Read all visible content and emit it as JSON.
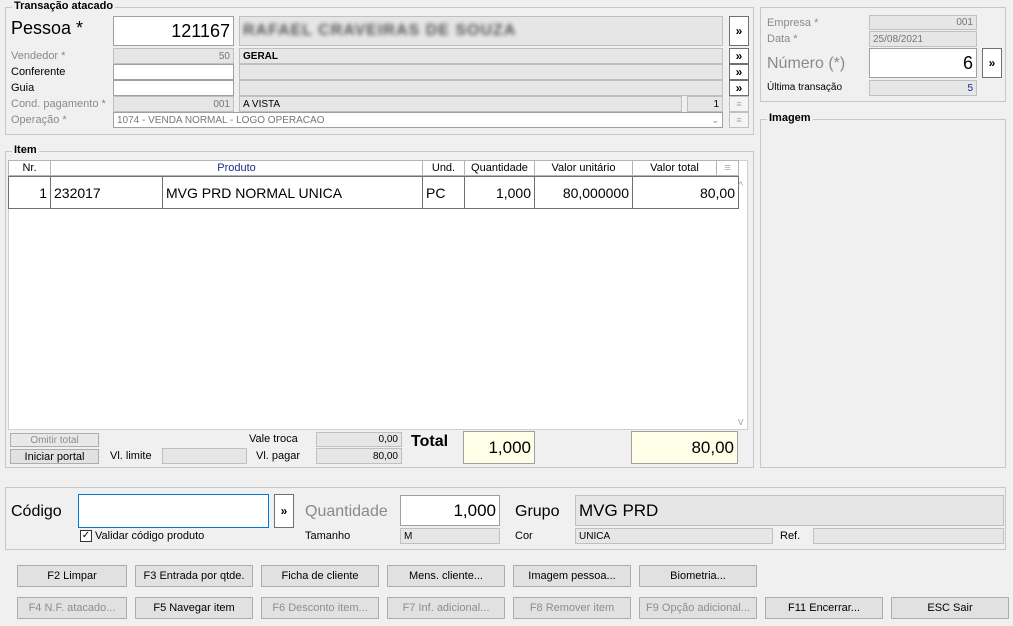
{
  "transacao": {
    "title": "Transação atacado",
    "pessoa_label": "Pessoa *",
    "pessoa_code": "121167",
    "pessoa_name": "RAFAEL CRAVEIRAS DE SOUZA",
    "vendedor_label": "Vendedor *",
    "vendedor_code": "50",
    "vendedor_name": "GERAL",
    "conferente_label": "Conferente",
    "guia_label": "Guia",
    "cond_label": "Cond. pagamento *",
    "cond_code": "001",
    "cond_name": "A VISTA",
    "cond_parcelas": "1",
    "operacao_label": "Operação *",
    "operacao_value": "1074 - VENDA NORMAL - LOGO OPERACAO"
  },
  "empresa": {
    "empresa_label": "Empresa *",
    "empresa_value": "001",
    "data_label": "Data *",
    "data_value": "25/08/2021",
    "numero_label": "Número (*)",
    "numero_value": "6",
    "ultima_label": "Última transação",
    "ultima_value": "5"
  },
  "imagem": {
    "title": "Imagem"
  },
  "item": {
    "title": "Item",
    "columns": [
      "Nr.",
      "Produto",
      "Und.",
      "Quantidade",
      "Valor unitário",
      "Valor total"
    ],
    "rows": [
      {
        "nr": "1",
        "codigo": "232017",
        "produto": "MVG PRD NORMAL UNICA",
        "und": "PC",
        "quantidade": "1,000",
        "valor_unitario": "80,000000",
        "valor_total": "80,00"
      }
    ]
  },
  "totals": {
    "omitir_total": "Omitir total",
    "iniciar_portal": "Iniciar portal",
    "vl_limite_label": "Vl. limite",
    "vl_limite_value": "",
    "vale_troca_label": "Vale troca",
    "vale_troca_value": "0,00",
    "vl_pagar_label": "Vl. pagar",
    "vl_pagar_value": "80,00",
    "total_label": "Total",
    "total_quantidade": "1,000",
    "total_valor": "80,00"
  },
  "codigo": {
    "codigo_label": "Código",
    "codigo_value": "",
    "validar_label": "Validar código produto",
    "validar_checked": true,
    "quantidade_label": "Quantidade",
    "quantidade_value": "1,000",
    "tamanho_label": "Tamanho",
    "tamanho_value": "M",
    "grupo_label": "Grupo",
    "grupo_value": "MVG PRD",
    "cor_label": "Cor",
    "cor_value": "UNICA",
    "ref_label": "Ref.",
    "ref_value": ""
  },
  "buttons": {
    "f2": "F2 Limpar",
    "f3": "F3 Entrada por qtde.",
    "ficha": "Ficha de cliente",
    "mens": "Mens. cliente...",
    "imagem_pessoa": "Imagem pessoa...",
    "biometria": "Biometria...",
    "f4": "F4 N.F. atacado...",
    "f5": "F5 Navegar item",
    "f6": "F6 Desconto item...",
    "f7": "F7 Inf. adicional...",
    "f8": "F8 Remover item",
    "f9": "F9 Opção adicional...",
    "f11": "F11 Encerrar...",
    "esc": "ESC Sair"
  },
  "icons": {
    "arrow": "»",
    "scroll_up": "^",
    "scroll_down": "v",
    "grip": "≡"
  },
  "colors": {
    "highlight_total": "#ffffe8",
    "ultima_value": "#1a2d8c"
  }
}
